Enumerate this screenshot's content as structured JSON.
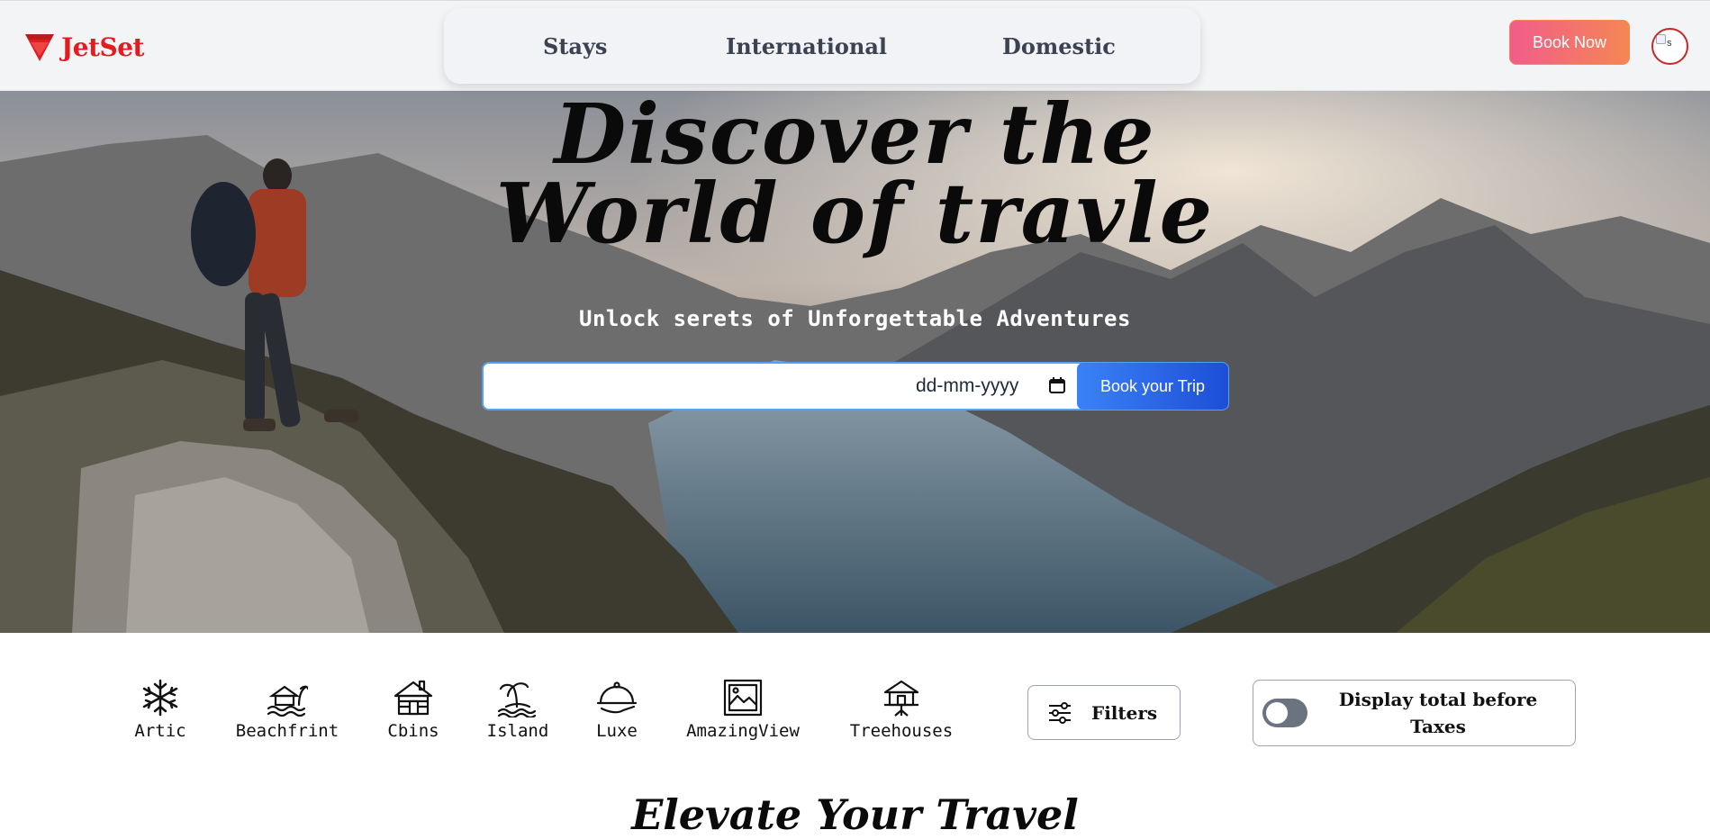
{
  "header": {
    "brand": "JetSet",
    "nav": [
      {
        "label": "Stays"
      },
      {
        "label": "International"
      },
      {
        "label": "Domestic"
      }
    ],
    "book_now": "Book Now",
    "avatar_alt": "s"
  },
  "hero": {
    "title_line1": "Discover the",
    "title_line2": "World of travle",
    "subtitle": "Unlock serets of Unforgettable Adventures",
    "date_placeholder": "dd-mm-yyyy",
    "cta": "Book your Trip"
  },
  "categories": [
    {
      "label": "Artic",
      "icon": "snowflake-icon"
    },
    {
      "label": "Beachfrint",
      "icon": "beach-hut-icon"
    },
    {
      "label": "Cbins",
      "icon": "cabin-icon"
    },
    {
      "label": "Island",
      "icon": "island-icon"
    },
    {
      "label": "Luxe",
      "icon": "cloche-icon"
    },
    {
      "label": "AmazingView",
      "icon": "landscape-frame-icon"
    },
    {
      "label": "Treehouses",
      "icon": "treehouse-icon"
    }
  ],
  "filters": {
    "label": "Filters"
  },
  "tax_toggle": {
    "label": "Display total before Taxes",
    "enabled": false
  },
  "section": {
    "title": "Elevate Your Travel"
  },
  "colors": {
    "brand": "#e11d22",
    "cta_start": "#f15c8b",
    "cta_end": "#f58654",
    "primary": "#2563eb"
  }
}
